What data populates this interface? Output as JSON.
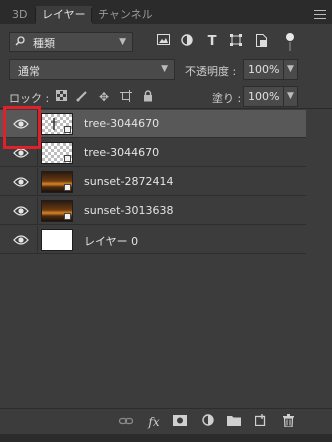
{
  "tabs": [
    {
      "label": "3D",
      "active": false
    },
    {
      "label": "レイヤー",
      "active": true
    },
    {
      "label": "チャンネル",
      "active": false
    }
  ],
  "filter": {
    "kind_label": "種類",
    "icons": [
      "image-filter-icon",
      "adjustment-filter-icon",
      "type-filter-icon",
      "shape-filter-icon",
      "smart-object-filter-icon"
    ]
  },
  "blend": {
    "mode": "通常"
  },
  "opacity": {
    "label": "不透明度 :",
    "value": "100%"
  },
  "lock": {
    "label": "ロック :"
  },
  "fill": {
    "label": "塗り :",
    "value": "100%"
  },
  "layers": [
    {
      "name": "tree-3044670",
      "visible": true,
      "selected": true,
      "thumb": "checker",
      "smart_object": true
    },
    {
      "name": "tree-3044670",
      "visible": true,
      "selected": false,
      "thumb": "checker",
      "smart_object": true
    },
    {
      "name": "sunset-2872414",
      "visible": true,
      "selected": false,
      "thumb": "sunset",
      "smart_object": true
    },
    {
      "name": "sunset-3013638",
      "visible": true,
      "selected": false,
      "thumb": "sunset",
      "smart_object": true
    },
    {
      "name": "レイヤー 0",
      "visible": true,
      "selected": false,
      "thumb": "white",
      "smart_object": false
    }
  ],
  "bottom_actions": [
    "link-layers-icon",
    "fx-icon",
    "add-mask-icon",
    "adjustment-layer-icon",
    "group-folder-icon",
    "new-layer-icon",
    "trash-icon"
  ],
  "colors": {
    "panel_bg": "#3c3c3c",
    "selected_row": "#585858",
    "highlight": "#e0202a"
  }
}
